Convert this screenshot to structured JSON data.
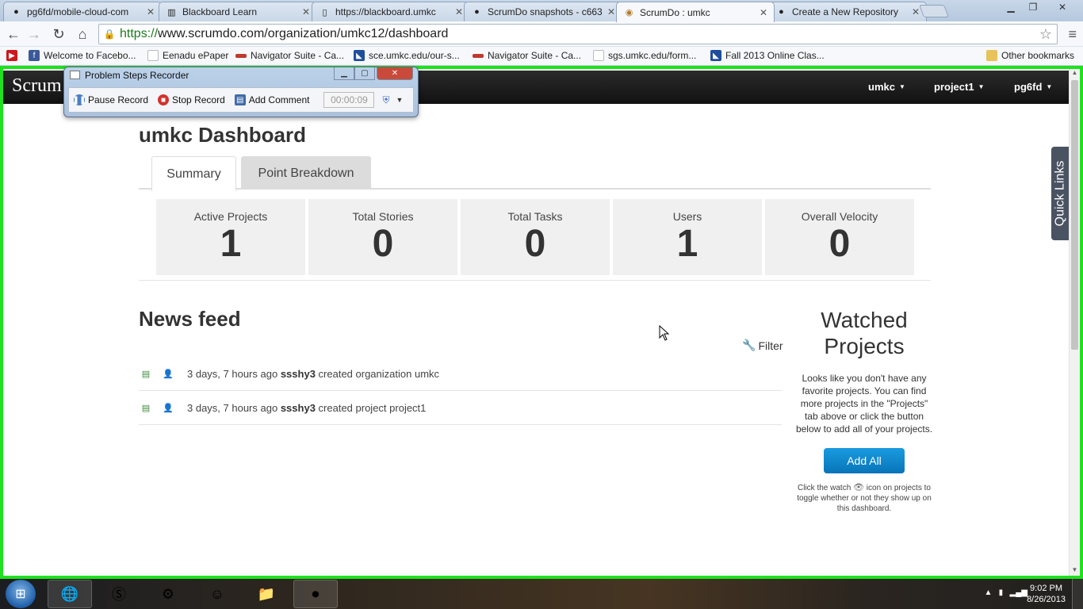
{
  "browser": {
    "tabs": [
      {
        "title": "pg6fd/mobile-cloud-com",
        "icon": "github-icon"
      },
      {
        "title": "Blackboard Learn",
        "icon": "blackboard-icon"
      },
      {
        "title": "https://blackboard.umkc",
        "icon": "page-icon"
      },
      {
        "title": "ScrumDo snapshots - c663",
        "icon": "github-icon"
      },
      {
        "title": "ScrumDo : umkc",
        "icon": "scrumdo-icon",
        "active": true
      },
      {
        "title": "Create a New Repository",
        "icon": "github-icon"
      }
    ],
    "url_scheme": "https://",
    "url_rest": "www.scrumdo.com/organization/umkc12/dashboard",
    "bookmarks": [
      {
        "label": "Welcome to Facebo...",
        "icon": "facebook-icon",
        "color": "#3b5998"
      },
      {
        "label": "Eenadu ePaper",
        "icon": "page-icon",
        "color": "#ffffff"
      },
      {
        "label": "Navigator Suite - Ca...",
        "icon": "navigator-icon",
        "color": "#c0392b"
      },
      {
        "label": "sce.umkc.edu/our-s...",
        "icon": "umkc-icon",
        "color": "#1f4e9c"
      },
      {
        "label": "Navigator Suite - Ca...",
        "icon": "navigator-icon",
        "color": "#c0392b"
      },
      {
        "label": "sgs.umkc.edu/form...",
        "icon": "page-icon",
        "color": "#ffffff"
      },
      {
        "label": "Fall 2013 Online Clas...",
        "icon": "umkc-icon",
        "color": "#1f4e9c"
      }
    ],
    "other_bookmarks": "Other bookmarks"
  },
  "site": {
    "brand": "Scrum",
    "menus": [
      "umkc",
      "project1",
      "pg6fd"
    ]
  },
  "dashboard": {
    "title": "umkc Dashboard",
    "tabs": [
      "Summary",
      "Point Breakdown"
    ],
    "stats": [
      {
        "label": "Active Projects",
        "value": "1"
      },
      {
        "label": "Total Stories",
        "value": "0"
      },
      {
        "label": "Total Tasks",
        "value": "0"
      },
      {
        "label": "Users",
        "value": "1"
      },
      {
        "label": "Overall Velocity",
        "value": "0"
      }
    ]
  },
  "news": {
    "title": "News feed",
    "filter": "Filter",
    "items": [
      {
        "time": "3 days, 7 hours ago",
        "user": "ssshy3",
        "action": "created organization umkc"
      },
      {
        "time": "3 days, 7 hours ago",
        "user": "ssshy3",
        "action": "created project project1"
      }
    ]
  },
  "watched": {
    "title": "Watched Projects",
    "description": "Looks like you don't have any favorite projects. You can find more projects in the \"Projects\" tab above or click the button below to add all of your projects.",
    "button": "Add All",
    "note_before": "Click the watch",
    "note_after": "icon on projects to toggle whether or not they show up on this dashboard."
  },
  "quick_links": "Quick Links",
  "recorder": {
    "title": "Problem Steps Recorder",
    "pause": "Pause Record",
    "stop": "Stop Record",
    "comment": "Add Comment",
    "timer": "00:00:09"
  },
  "taskbar": {
    "time": "9:02 PM",
    "date": "8/26/2013"
  },
  "colors": {
    "highlight_border": "#1de21d",
    "button_blue": "#1a9be0",
    "header_dark": "#1a1a1a"
  }
}
